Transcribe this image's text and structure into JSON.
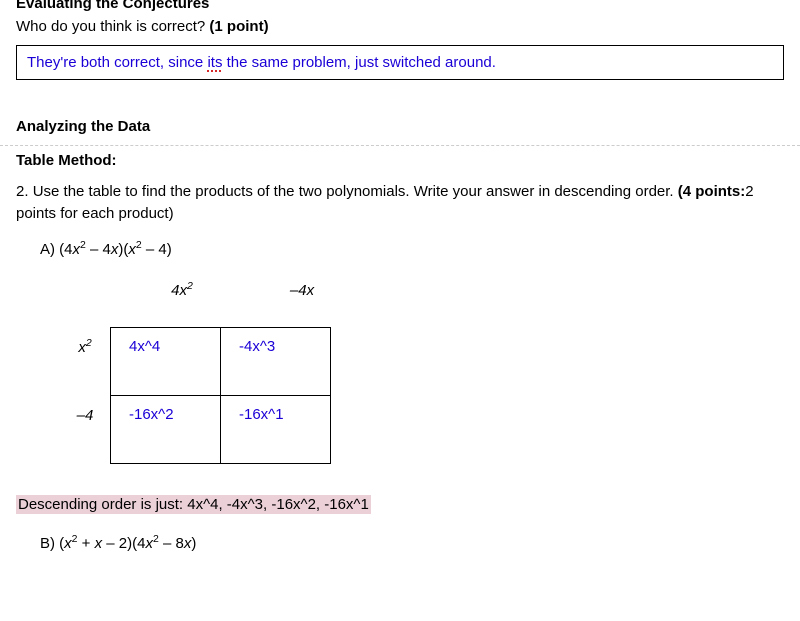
{
  "headings": {
    "evaluating": "Evaluating the Conjectures",
    "analyzing": "Analyzing the Data",
    "tableMethod": "Table Method:"
  },
  "q1": {
    "text": "Who do you think is correct? ",
    "points": "(1 point)"
  },
  "answer1": {
    "part1": "They're both correct, since ",
    "underlined": "its",
    "part2": " the same problem, just switched around."
  },
  "q2": {
    "num": "2. ",
    "text": "Use the table to find the products of the two polynomials. Write your answer in descending order. ",
    "pointsLabel": "(4 points:",
    "pointsRest": "2 points for each product)"
  },
  "problemA": {
    "label": "A) (4",
    "x2": "x",
    "sup2": "2",
    "mid": " – 4",
    "x": "x",
    "close1": ")(",
    "x2b": "x",
    "sup2b": "2",
    "end": " – 4)"
  },
  "table": {
    "colHeaders": {
      "c1": "4x",
      "c1sup": "2",
      "c2": "–4x"
    },
    "rowHeaders": {
      "r1": "x",
      "r1sup": "2",
      "r2": "–4"
    },
    "cells": {
      "c11": "4x^4",
      "c12": "-4x^3",
      "c21": "-16x^2",
      "c22": "-16x^1"
    }
  },
  "descending": {
    "label": "Descending order is just: ",
    "values": "4x^4, -4x^3, -16x^2, -16x^1"
  },
  "problemB": {
    "label": "B) (",
    "x2": "x",
    "sup2": "2",
    "mid": " + ",
    "x": "x",
    "mid2": " – 2)(4",
    "x2b": "x",
    "sup2b": "2",
    "end": " – 8",
    "xb": "x",
    "close": ")"
  }
}
